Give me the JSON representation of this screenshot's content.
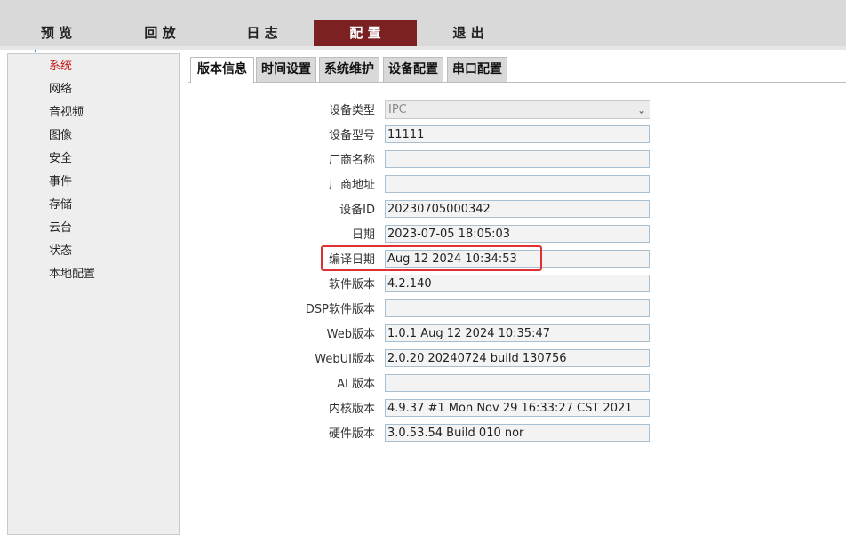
{
  "topnav": {
    "preview": "预 览",
    "playback": "回 放",
    "log": "日 志",
    "config": "配 置",
    "exit": "退 出"
  },
  "sidebar": {
    "items": [
      {
        "label": "系统",
        "active": true
      },
      {
        "label": "网络"
      },
      {
        "label": "音视频"
      },
      {
        "label": "图像"
      },
      {
        "label": "安全"
      },
      {
        "label": "事件"
      },
      {
        "label": "存储"
      },
      {
        "label": "云台"
      },
      {
        "label": "状态"
      },
      {
        "label": "本地配置"
      }
    ]
  },
  "tabs": [
    {
      "label": "版本信息",
      "active": true
    },
    {
      "label": "时间设置"
    },
    {
      "label": "系统维护"
    },
    {
      "label": "设备配置"
    },
    {
      "label": "串口配置"
    }
  ],
  "form": {
    "device_type": {
      "label": "设备类型",
      "value": "IPC"
    },
    "device_model": {
      "label": "设备型号",
      "value": "11111"
    },
    "vendor_name": {
      "label": "厂商名称",
      "value": ""
    },
    "vendor_address": {
      "label": "厂商地址",
      "value": ""
    },
    "device_id": {
      "label": "设备ID",
      "value": "20230705000342"
    },
    "date": {
      "label": "日期",
      "value": "2023-07-05 18:05:03"
    },
    "build_date": {
      "label": "编译日期",
      "value": "Aug 12 2024 10:34:53"
    },
    "software_version": {
      "label": "软件版本",
      "value": "4.2.140"
    },
    "dsp_version": {
      "label": "DSP软件版本",
      "value": ""
    },
    "web_version": {
      "label": "Web版本",
      "value": "1.0.1 Aug 12 2024 10:35:47"
    },
    "webui_version": {
      "label": "WebUI版本",
      "value": "2.0.20 20240724 build 130756"
    },
    "ai_version": {
      "label": "AI 版本",
      "value": ""
    },
    "kernel_version": {
      "label": "内核版本",
      "value": "4.9.37 #1 Mon Nov 29 16:33:27 CST 2021"
    },
    "hardware_version": {
      "label": "硬件版本",
      "value": "3.0.53.54 Build 010 nor"
    }
  },
  "colors": {
    "active_nav_bg": "#7b2121",
    "active_sidebar_text": "#c0191a",
    "highlight_border": "#e13030"
  }
}
